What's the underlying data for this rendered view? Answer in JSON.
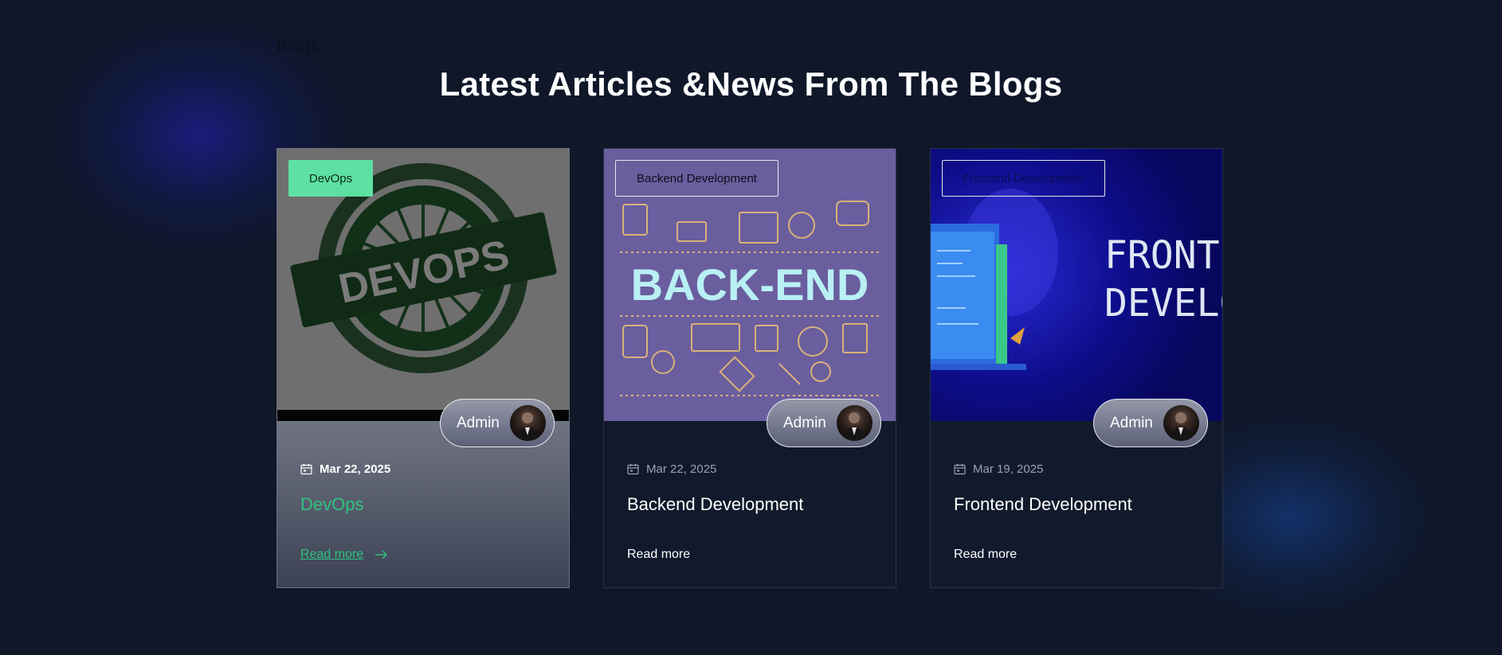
{
  "section": {
    "eyebrow": "Blogs",
    "heading": "Latest Articles &News From The Blogs"
  },
  "colors": {
    "background": "#0f1729",
    "accent_green": "#2ec47f",
    "tag_green": "#5ee0a2"
  },
  "cards": [
    {
      "tag": "DevOps",
      "author": "Admin",
      "date": "Mar 22, 2025",
      "title": "DevOps",
      "read_more": "Read more",
      "image_text": "DEVOPS",
      "state": "hovered"
    },
    {
      "tag": "Backend Development",
      "author": "Admin",
      "date": "Mar 22, 2025",
      "title": "Backend Development",
      "read_more": "Read more",
      "image_text": "BACK-END"
    },
    {
      "tag": "Frontend Development",
      "author": "Admin",
      "date": "Mar 19, 2025",
      "title": "Frontend Development",
      "read_more": "Read more",
      "image_text_line1": "FRONT-",
      "image_text_line2": "DEVELO"
    }
  ],
  "icons": {
    "date": "calendar-icon",
    "read_more": "arrow-right-icon"
  }
}
